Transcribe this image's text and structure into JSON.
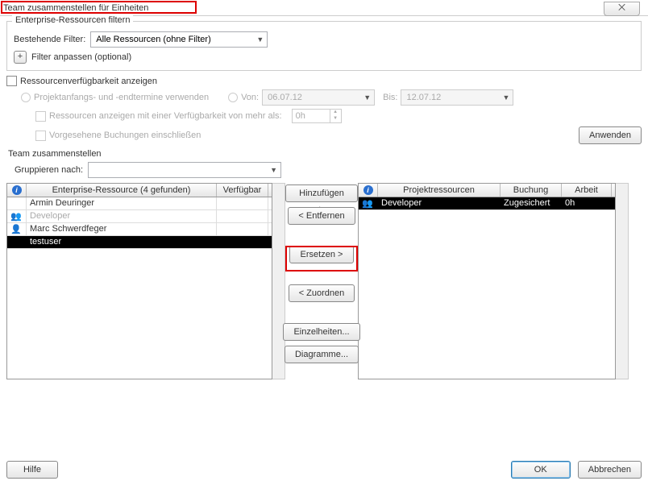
{
  "title": "Team zusammenstellen für Einheiten",
  "close_glyph": "⨉",
  "filterbox": {
    "title": "Enterprise-Ressourcen filtern",
    "existing_label": "Bestehende Filter:",
    "existing_value": "Alle Ressourcen (ohne Filter)",
    "customize": "Filter anpassen (optional)",
    "plus": "+"
  },
  "avail": {
    "show": "Ressourcenverfügbarkeit anzeigen",
    "usedates": "Projektanfangs- und -endtermine verwenden",
    "von": "Von:",
    "bis": "Bis:",
    "date_from": "06.07.12",
    "date_to": "12.07.12",
    "minavail": "Ressourcen anzeigen mit einer Verfügbarkeit von mehr als:",
    "minavail_val": "0h",
    "proposed": "Vorgesehene Buchungen einschließen",
    "apply": "Anwenden"
  },
  "team": {
    "title": "Team zusammenstellen",
    "group_label": "Gruppieren nach:",
    "group_value": ""
  },
  "left_grid": {
    "h_res": "Enterprise-Ressource (4 gefunden)",
    "h_avail": "Verfügbar",
    "rows": [
      {
        "name": "Armin Deuringer",
        "dim": false,
        "ico": ""
      },
      {
        "name": "Developer",
        "dim": true,
        "ico": "g"
      },
      {
        "name": "Marc Schwerdfeger",
        "dim": false,
        "ico": "p"
      },
      {
        "name": "testuser",
        "dim": false,
        "ico": "",
        "sel": true
      }
    ]
  },
  "right_grid": {
    "h_res": "Projektressourcen",
    "h_book": "Buchung",
    "h_work": "Arbeit",
    "rows": [
      {
        "name": "Developer",
        "book": "Zugesichert",
        "work": "0h",
        "sel": true,
        "ico": "g"
      }
    ]
  },
  "mid": {
    "add": "Hinzufügen >",
    "remove": "< Entfernen",
    "replace": "Ersetzen >",
    "assign": "< Zuordnen",
    "details": "Einzelheiten...",
    "charts": "Diagramme..."
  },
  "bottom": {
    "help": "Hilfe",
    "ok": "OK",
    "cancel": "Abbrechen"
  }
}
